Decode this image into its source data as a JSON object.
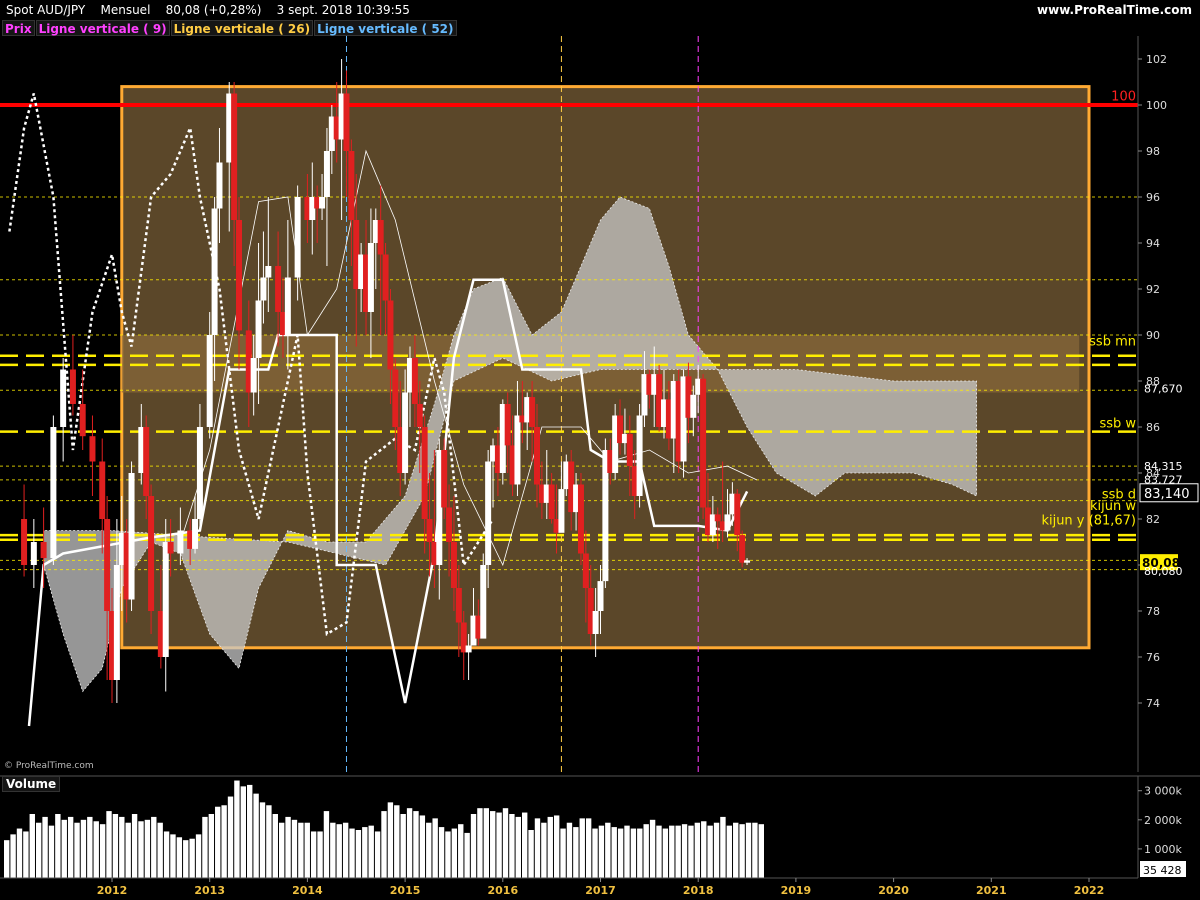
{
  "header": {
    "instrument": "Spot AUD/JPY",
    "period": "Mensuel",
    "quote": "80,08 (+0,28%)",
    "datetime": "3 sept. 2018 10:39:55",
    "site": "www.ProRealTime.com"
  },
  "legend": [
    {
      "label": "Prix",
      "color": "#ff40ff"
    },
    {
      "label": "Ligne verticale ( 9)",
      "color": "#ff40ff"
    },
    {
      "label": "Ligne verticale ( 26)",
      "color": "#ffcc44"
    },
    {
      "label": "Ligne verticale ( 52)",
      "color": "#66bbff"
    }
  ],
  "watermark": "© ProRealTime.com",
  "volume_title": "Volume",
  "colors": {
    "background": "#000000",
    "box_fill": "#6b5330",
    "box_border": "#ffaa33",
    "bull": "#ffffff",
    "bear": "#e02020",
    "level_line": "#ffee00",
    "cloud": "#c8c8c8",
    "line100": "#ff0000"
  },
  "chart_data": [
    {
      "type": "candlestick",
      "title": "Spot AUD/JPY",
      "ylim": [
        71,
        103
      ],
      "y_ticks": [
        74,
        76,
        78,
        80,
        82,
        84,
        86,
        88,
        90,
        92,
        94,
        96,
        98,
        100,
        102
      ],
      "x_ticks": [
        "2012",
        "2013",
        "2014",
        "2015",
        "2016",
        "2017",
        "2018",
        "2019",
        "2020",
        "2021",
        "2022"
      ],
      "price_labels": [
        {
          "text": "87,670",
          "value": 87.67,
          "style": "plain"
        },
        {
          "text": "84,315",
          "value": 84.315,
          "style": "plain"
        },
        {
          "text": "83,727",
          "value": 83.727,
          "style": "plain"
        },
        {
          "text": "83,140",
          "value": 83.14,
          "style": "boxed"
        },
        {
          "text": "80,08",
          "value": 80.08,
          "style": "yellow"
        },
        {
          "text": "80,080",
          "value": 80.08,
          "style": "plain"
        }
      ],
      "level_labels": [
        {
          "text": "100",
          "value": 100.1,
          "color": "#ff2020"
        },
        {
          "text": "ssb mn",
          "value": 89.45,
          "color": "#ffee00"
        },
        {
          "text": "ssb w",
          "value": 85.9,
          "color": "#ffee00"
        },
        {
          "text": "ssb d",
          "value": 82.8,
          "color": "#ffee00"
        },
        {
          "text": "kijun w",
          "value": 82.3,
          "color": "#ffee00"
        },
        {
          "text": "kijun y (81,67)",
          "value": 81.67,
          "color": "#ffee00"
        }
      ],
      "horizontal_lines": [
        {
          "value": 100.0,
          "style": "solid",
          "color": "#ff0000"
        },
        {
          "value": 89.1,
          "style": "dashed-heavy",
          "color": "#ffee00"
        },
        {
          "value": 88.7,
          "style": "dashed-heavy",
          "color": "#ffee00"
        },
        {
          "value": 85.8,
          "style": "dashed-heavy",
          "color": "#ffee00"
        },
        {
          "value": 81.3,
          "style": "dashed-heavy",
          "color": "#ffee00"
        },
        {
          "value": 81.1,
          "style": "dashed-heavy",
          "color": "#ffee00"
        },
        {
          "value": 96.0,
          "style": "dotted",
          "color": "#ffee00"
        },
        {
          "value": 92.4,
          "style": "dotted",
          "color": "#ffee00"
        },
        {
          "value": 90.0,
          "style": "dotted",
          "color": "#ffee00"
        },
        {
          "value": 87.6,
          "style": "dotted",
          "color": "#ffee00"
        },
        {
          "value": 84.3,
          "style": "dotted",
          "color": "#ffee00"
        },
        {
          "value": 83.7,
          "style": "dotted",
          "color": "#ffee00"
        },
        {
          "value": 82.8,
          "style": "dotted",
          "color": "#ffee00"
        },
        {
          "value": 80.2,
          "style": "dotted",
          "color": "#ffee00"
        },
        {
          "value": 79.8,
          "style": "dotted",
          "color": "#ffee00"
        }
      ],
      "vertical_lines": [
        {
          "date": "2014.4",
          "color": "#66bbff"
        },
        {
          "date": "2016.6",
          "color": "#ffcc44"
        },
        {
          "date": "2018.0",
          "color": "#ff40ff"
        }
      ],
      "zones": [
        {
          "x": [
            2012.1,
            2022.0
          ],
          "y": [
            76.4,
            100.8
          ],
          "fill": "#6b5330"
        },
        {
          "x": [
            2012.1,
            2021.9
          ],
          "y": [
            87.5,
            90.0
          ],
          "fill": "#8a6a3a"
        }
      ],
      "candles": [
        [
          2011.1,
          82,
          80,
          83.5,
          79.5
        ],
        [
          2011.2,
          80,
          81,
          82,
          79
        ],
        [
          2011.3,
          81,
          80.3,
          82.5,
          79
        ],
        [
          2011.4,
          80.3,
          86,
          86.5,
          80
        ],
        [
          2011.5,
          86,
          88.5,
          89,
          84.5
        ],
        [
          2011.6,
          88.5,
          87,
          90,
          86.5
        ],
        [
          2011.7,
          87,
          85.6,
          88.5,
          85
        ],
        [
          2011.8,
          85.6,
          84.5,
          86.5,
          83
        ],
        [
          2011.9,
          84.5,
          82,
          85.5,
          80.5
        ],
        [
          2011.95,
          82,
          78,
          83,
          75
        ],
        [
          2012.0,
          78,
          75,
          79,
          74
        ],
        [
          2012.05,
          75,
          80,
          82,
          74
        ],
        [
          2012.1,
          80,
          81.4,
          83,
          78
        ],
        [
          2012.15,
          81.4,
          78.5,
          82,
          77.5
        ],
        [
          2012.2,
          78.5,
          84,
          84.5,
          78
        ],
        [
          2012.3,
          84,
          86,
          87,
          83.5
        ],
        [
          2012.35,
          86,
          83,
          86.5,
          82
        ],
        [
          2012.4,
          83,
          78,
          83.5,
          77
        ],
        [
          2012.5,
          78,
          76,
          80,
          75.5
        ],
        [
          2012.55,
          76,
          81,
          82,
          74.5
        ],
        [
          2012.6,
          81,
          80.5,
          82,
          79.5
        ],
        [
          2012.7,
          80.5,
          81.5,
          82.5,
          80
        ],
        [
          2012.8,
          81.5,
          80.7,
          82,
          80
        ],
        [
          2012.85,
          80.7,
          82,
          83,
          80.5
        ],
        [
          2012.9,
          82,
          86,
          87,
          81.5
        ],
        [
          2013.0,
          86,
          90,
          91,
          85.5
        ],
        [
          2013.05,
          90,
          95.5,
          96,
          88
        ],
        [
          2013.1,
          95.5,
          97.5,
          99,
          94
        ],
        [
          2013.2,
          97.5,
          100.5,
          101,
          94.5
        ],
        [
          2013.25,
          100.5,
          95,
          101,
          93
        ],
        [
          2013.3,
          95,
          90.2,
          96,
          88.5
        ],
        [
          2013.4,
          90.2,
          87.5,
          91.5,
          86
        ],
        [
          2013.45,
          87.5,
          89,
          90,
          86.5
        ],
        [
          2013.5,
          89,
          91.5,
          94,
          87
        ],
        [
          2013.55,
          91.5,
          92.5,
          94.5,
          90.5
        ],
        [
          2013.6,
          92.5,
          93,
          96,
          91
        ],
        [
          2013.7,
          93,
          91,
          94.5,
          89.5
        ],
        [
          2013.75,
          91,
          90,
          92.5,
          89
        ],
        [
          2013.8,
          90,
          92.5,
          95,
          88.5
        ],
        [
          2013.9,
          92.5,
          96,
          96.5,
          91.5
        ],
        [
          2014.0,
          96,
          95,
          97,
          94
        ],
        [
          2014.05,
          95,
          96,
          97.5,
          93.5
        ],
        [
          2014.1,
          96,
          95.5,
          96.5,
          94
        ],
        [
          2014.15,
          95.5,
          96,
          97,
          95
        ],
        [
          2014.2,
          96,
          98,
          99,
          93
        ],
        [
          2014.25,
          98,
          99.5,
          100,
          97
        ],
        [
          2014.3,
          99.5,
          98.5,
          101,
          97.5
        ],
        [
          2014.35,
          98.5,
          100.5,
          102,
          95
        ],
        [
          2014.4,
          100.5,
          98,
          101.5,
          96
        ],
        [
          2014.45,
          98,
          95,
          98.5,
          93
        ],
        [
          2014.5,
          95,
          92,
          97,
          89.5
        ],
        [
          2014.55,
          92,
          93.5,
          94,
          91
        ],
        [
          2014.6,
          93.5,
          91,
          95,
          90
        ],
        [
          2014.65,
          91,
          94,
          95.5,
          89
        ],
        [
          2014.7,
          94,
          95,
          95.5,
          92
        ],
        [
          2014.75,
          95,
          93.5,
          96.5,
          90
        ],
        [
          2014.8,
          93.5,
          91.5,
          94,
          90
        ],
        [
          2014.85,
          91.5,
          88.5,
          92,
          87
        ],
        [
          2014.9,
          88.5,
          86,
          89,
          85
        ],
        [
          2014.95,
          86,
          84,
          88,
          83
        ],
        [
          2015.0,
          84,
          87.5,
          88.5,
          83.5
        ],
        [
          2015.05,
          87.5,
          89,
          89.5,
          86
        ],
        [
          2015.1,
          89,
          87,
          90,
          86
        ],
        [
          2015.15,
          87,
          86,
          88,
          84
        ],
        [
          2015.2,
          86,
          82,
          86.5,
          80.5
        ],
        [
          2015.25,
          82,
          81,
          84,
          79.5
        ],
        [
          2015.3,
          81,
          80,
          85,
          79
        ],
        [
          2015.35,
          80,
          85,
          85.5,
          78.5
        ],
        [
          2015.4,
          85,
          82.5,
          85.5,
          82
        ],
        [
          2015.45,
          82.5,
          81,
          83.5,
          79.5
        ],
        [
          2015.5,
          81,
          79,
          83,
          78
        ],
        [
          2015.55,
          79,
          77.5,
          80,
          76
        ],
        [
          2015.6,
          77.5,
          76.2,
          78,
          75
        ],
        [
          2015.65,
          76.2,
          76.5,
          77,
          75
        ],
        [
          2015.7,
          76.5,
          77.8,
          79,
          76.5
        ],
        [
          2015.75,
          77.8,
          76.8,
          78.5,
          76.5
        ],
        [
          2015.8,
          76.8,
          80,
          80.5,
          77.5
        ],
        [
          2015.85,
          80,
          84.5,
          85,
          79
        ],
        [
          2015.9,
          84.5,
          85.2,
          85.5,
          82.5
        ],
        [
          2015.95,
          85.2,
          84,
          86,
          83
        ],
        [
          2016.0,
          84,
          87,
          87.2,
          83.5
        ],
        [
          2016.05,
          87,
          85.2,
          87.5,
          84
        ],
        [
          2016.1,
          85.2,
          83.5,
          86.5,
          83
        ],
        [
          2016.15,
          83.5,
          86.5,
          88,
          83
        ],
        [
          2016.2,
          86.5,
          86.2,
          88,
          85.3
        ],
        [
          2016.25,
          86.2,
          87.3,
          87.5,
          85
        ],
        [
          2016.3,
          87.3,
          86,
          88,
          84.5
        ],
        [
          2016.35,
          86,
          83.5,
          87,
          82.5
        ],
        [
          2016.4,
          83.5,
          82.7,
          84.5,
          82
        ],
        [
          2016.45,
          82.7,
          83.5,
          85,
          82
        ],
        [
          2016.5,
          83.5,
          82,
          84,
          81.8
        ],
        [
          2016.55,
          82,
          81.4,
          83.5,
          80.5
        ],
        [
          2016.6,
          81.4,
          83.3,
          84.5,
          81.5
        ],
        [
          2016.65,
          83.3,
          84.5,
          84.8,
          83
        ],
        [
          2016.7,
          84.5,
          82.3,
          85,
          81.5
        ],
        [
          2016.75,
          82.3,
          83.5,
          84,
          81.5
        ],
        [
          2016.8,
          83.5,
          80.5,
          84,
          80
        ]
      ],
      "volume": {
        "y_ticks": [
          "3 000k",
          "2 000k",
          "1 000k"
        ],
        "tick_values": [
          3000,
          2000,
          1000
        ],
        "last_label": "35 428",
        "ylim_k": [
          0,
          3300
        ],
        "bars_k": [
          1300,
          1500,
          1700,
          1600,
          2200,
          1900,
          2100,
          1800,
          2200,
          2000,
          2100,
          1900,
          2000,
          2100,
          1950,
          1850,
          2300,
          2200,
          2100,
          1900,
          2200,
          1950,
          2000,
          2100,
          1900,
          1600,
          1500,
          1400,
          1300,
          1350,
          1500,
          2100,
          2200,
          2450,
          2500,
          2800,
          3350,
          3150,
          3200,
          2900,
          2600,
          2500,
          2200,
          1900,
          2100,
          2000,
          1900,
          1900,
          1600,
          1600,
          2300,
          1900,
          1850,
          1900,
          1700,
          1650,
          1750,
          1800,
          1600,
          2300,
          2600,
          2500,
          2200,
          2400,
          2300,
          2150,
          1900,
          2050,
          1750,
          1600,
          1700,
          1850,
          1550,
          2200,
          2400,
          2400,
          2300,
          2250,
          2400,
          2200,
          2100,
          2250,
          1650,
          2050,
          1900,
          2100,
          2150,
          1700,
          1900,
          1750,
          2050,
          2050,
          1700,
          1800,
          1900,
          1750,
          1700,
          1800,
          1700,
          1700,
          1850,
          2000,
          1800,
          1700,
          1800,
          1800,
          1850,
          1800,
          1900,
          1950,
          1800,
          1900,
          2100,
          1800,
          1900,
          1850,
          1900,
          1900,
          1850,
          0.035
        ]
      }
    }
  ]
}
